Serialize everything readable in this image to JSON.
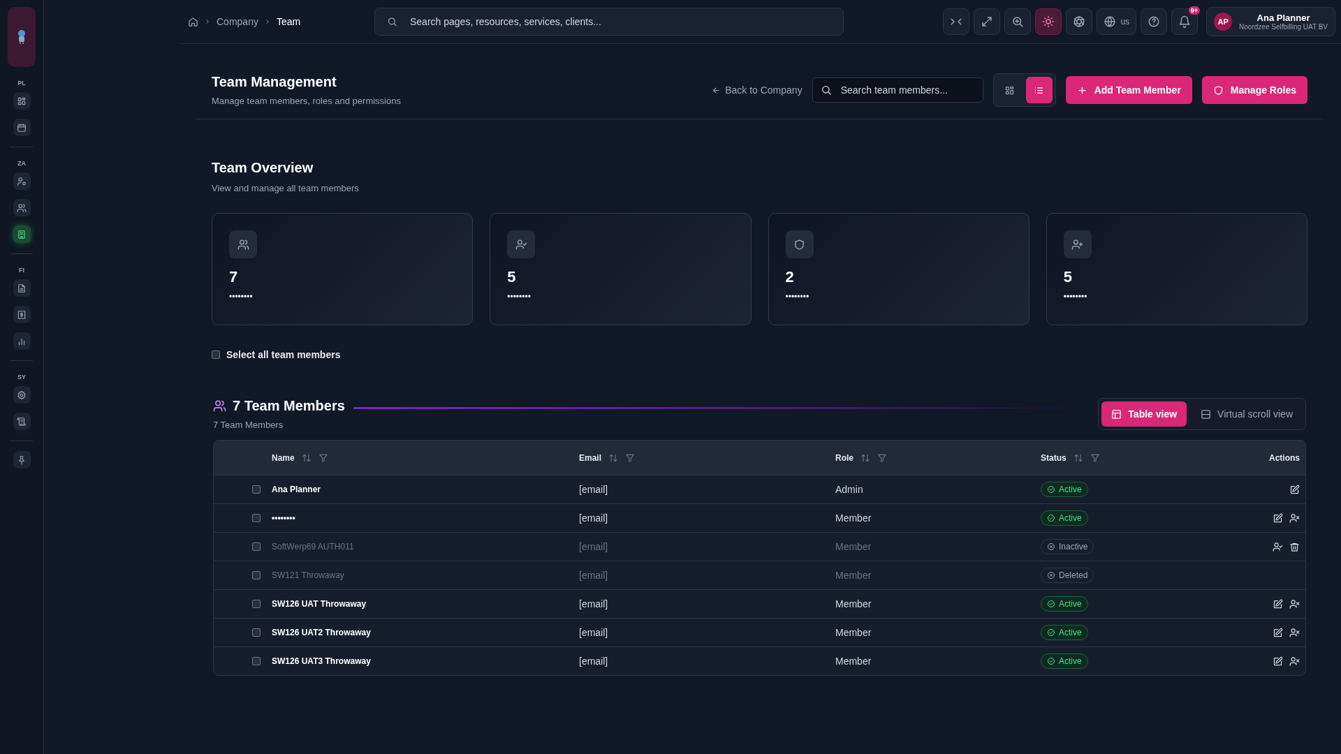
{
  "sidebar": {
    "groups": [
      {
        "label": "PL",
        "items": [
          {
            "kind": "grid",
            "selected": false
          },
          {
            "kind": "calendar",
            "selected": false
          }
        ]
      },
      {
        "label": "ZA",
        "items": [
          {
            "kind": "user-gear",
            "selected": false
          },
          {
            "kind": "users",
            "selected": false
          },
          {
            "kind": "building",
            "selected": true
          }
        ]
      },
      {
        "label": "FI",
        "items": [
          {
            "kind": "file",
            "selected": false
          },
          {
            "kind": "receipt",
            "selected": false
          },
          {
            "kind": "bar-chart",
            "selected": false
          }
        ]
      },
      {
        "label": "SY",
        "items": [
          {
            "kind": "gear",
            "selected": false
          },
          {
            "kind": "scroll",
            "selected": false
          }
        ]
      }
    ],
    "footer_items": [
      {
        "kind": "pin",
        "selected": false
      }
    ]
  },
  "breadcrumb": [
    "Company",
    "Team"
  ],
  "global_search": {
    "placeholder": "Search pages, resources, services, clients..."
  },
  "toolbar": [
    {
      "kind": "collapse",
      "selected": false
    },
    {
      "kind": "expand",
      "selected": false
    },
    {
      "kind": "zoom-in",
      "selected": false
    },
    {
      "kind": "sun",
      "selected": true
    },
    {
      "kind": "aperture",
      "selected": false
    },
    {
      "kind": "globe",
      "selected": false,
      "label": "us"
    },
    {
      "kind": "help",
      "selected": false
    },
    {
      "kind": "bell",
      "selected": false,
      "badge": "9+"
    }
  ],
  "user": {
    "initials": "AP",
    "name": "Ana Planner",
    "company": "Noordzee Selfbilling UAT BV"
  },
  "page": {
    "title": "Team Management",
    "subtitle": "Manage team members, roles and permissions",
    "back_link": "Back to Company",
    "search": {
      "placeholder": "Search team members..."
    },
    "view_toggle": [
      {
        "kind": "grid",
        "selected": false
      },
      {
        "kind": "list",
        "selected": true
      }
    ],
    "buttons": [
      {
        "kind": "plus",
        "label": "Add Team Member"
      },
      {
        "kind": "shield",
        "label": "Manage Roles"
      }
    ]
  },
  "overview": {
    "title": "Team Overview",
    "subtitle": "View and manage all team members",
    "cards": [
      {
        "kind": "users",
        "value": "7",
        "label": "••••••••"
      },
      {
        "kind": "user-check",
        "value": "5",
        "label": "••••••••"
      },
      {
        "kind": "shield",
        "value": "2",
        "label": "••••••••"
      },
      {
        "kind": "user-plus",
        "value": "5",
        "label": "••••••••"
      }
    ]
  },
  "select_all": {
    "label": "Select all team members",
    "checked": false
  },
  "members": {
    "title": "7 Team Members",
    "subtitle": "7 Team Members",
    "views": [
      {
        "kind": "table",
        "label": "Table view",
        "selected": true
      },
      {
        "kind": "rows",
        "label": "Virtual scroll view",
        "selected": false
      }
    ],
    "columns": [
      {
        "label": "Name",
        "kind": "sortable"
      },
      {
        "label": "Email",
        "kind": "sortable"
      },
      {
        "label": "Role",
        "kind": "sortable"
      },
      {
        "label": "Status",
        "kind": "sortable"
      },
      {
        "label": "Actions",
        "kind": "plain"
      }
    ],
    "rows": [
      {
        "name": "Ana Planner",
        "email": "[email]",
        "role": "Admin",
        "status": {
          "kind": "active",
          "label": "Active"
        },
        "checked": false,
        "actions": [
          {
            "kind": "edit"
          }
        ]
      },
      {
        "name": "••••••••",
        "email": "[email]",
        "role": "Member",
        "status": {
          "kind": "active",
          "label": "Active"
        },
        "checked": false,
        "actions": [
          {
            "kind": "edit"
          },
          {
            "kind": "user-x"
          }
        ]
      },
      {
        "name": "SoftWerp69 AUTH011",
        "email": "[email]",
        "role": "Member",
        "status": {
          "kind": "inactive",
          "label": "Inactive"
        },
        "checked": false,
        "actions": [
          {
            "kind": "user-check"
          },
          {
            "kind": "trash"
          }
        ]
      },
      {
        "name": "SW121 Throwaway",
        "email": "[email]",
        "role": "Member",
        "status": {
          "kind": "deleted",
          "label": "Deleted"
        },
        "checked": false
      },
      {
        "name": "SW126 UAT Throwaway",
        "email": "[email]",
        "role": "Member",
        "status": {
          "kind": "active",
          "label": "Active"
        },
        "checked": false,
        "actions": [
          {
            "kind": "edit"
          },
          {
            "kind": "user-x"
          }
        ]
      },
      {
        "name": "SW126 UAT2 Throwaway",
        "email": "[email]",
        "role": "Member",
        "status": {
          "kind": "active",
          "label": "Active"
        },
        "checked": false,
        "actions": [
          {
            "kind": "edit"
          },
          {
            "kind": "user-x"
          }
        ]
      },
      {
        "name": "SW126 UAT3 Throwaway",
        "email": "[email]",
        "role": "Member",
        "status": {
          "kind": "active",
          "label": "Active"
        },
        "checked": false,
        "actions": [
          {
            "kind": "edit"
          },
          {
            "kind": "user-x"
          }
        ]
      }
    ]
  }
}
